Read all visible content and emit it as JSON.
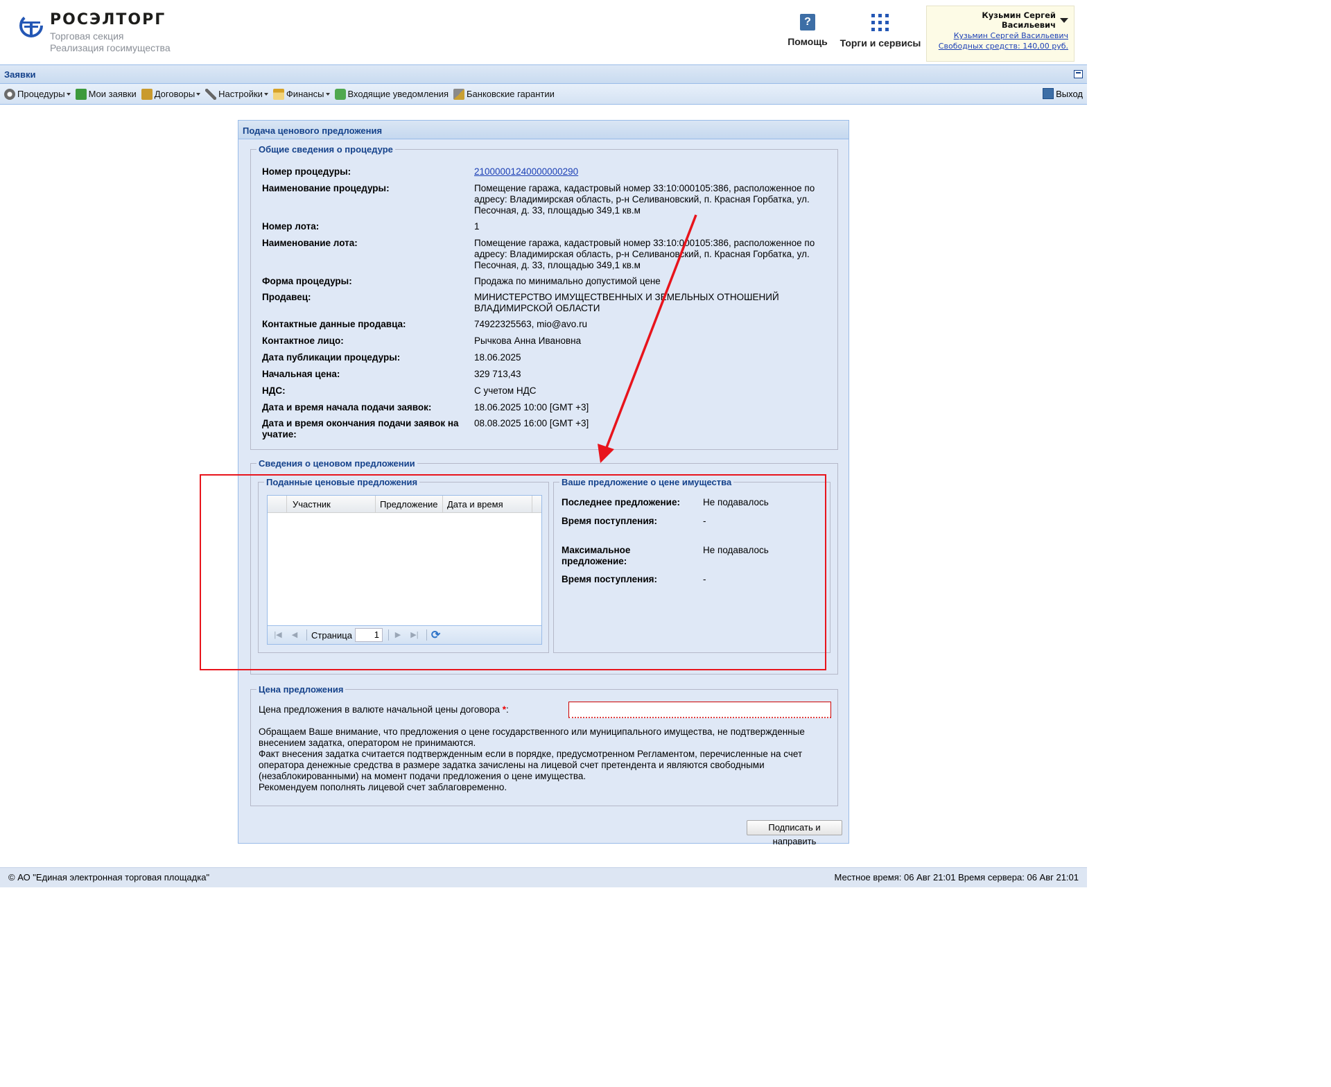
{
  "header": {
    "logo_title": "РОСЭЛТОРГ",
    "logo_sub1": "Торговая секция",
    "logo_sub2": "Реализация госимущества",
    "help_label": "Помощь",
    "services_label": "Торги и сервисы",
    "user_name": "Кузьмин Сергей Васильевич",
    "user_link": "Кузьмин Сергей Васильевич",
    "funds_link": "Свободных средств: 140,00 руб."
  },
  "panel": {
    "title": "Заявки"
  },
  "toolbar": {
    "items": [
      {
        "label": "Процедуры",
        "icon": "gear-icon"
      },
      {
        "label": "Мои заявки",
        "icon": "document-icon"
      },
      {
        "label": "Договоры",
        "icon": "contract-icon"
      },
      {
        "label": "Настройки",
        "icon": "wrench-icon"
      },
      {
        "label": "Финансы",
        "icon": "bank-icon"
      },
      {
        "label": "Входящие уведомления",
        "icon": "notification-icon"
      },
      {
        "label": "Банковские гарантии",
        "icon": "guarantee-icon"
      }
    ],
    "exit_label": "Выход"
  },
  "form": {
    "title": "Подача ценового предложения",
    "general_legend": "Общие сведения о процедуре",
    "general": [
      {
        "label": "Номер процедуры:",
        "value": "21000001240000000290"
      },
      {
        "label": "Наименование процедуры:",
        "value": "Помещение гаража, кадастровый номер 33:10:000105:386, расположенное по адресу: Владимирская область, р-н Селивановский, п. Красная Горбатка, ул. Песочная, д. 33, площадью 349,1 кв.м"
      },
      {
        "label": "Номер лота:",
        "value": "1"
      },
      {
        "label": "Наименование лота:",
        "value": "Помещение гаража, кадастровый номер 33:10:000105:386, расположенное по адресу: Владимирская область, р-н Селивановский, п. Красная Горбатка, ул. Песочная, д. 33, площадью 349,1 кв.м"
      },
      {
        "label": "Форма процедуры:",
        "value": "Продажа по минимально допустимой цене"
      },
      {
        "label": "Продавец:",
        "value": "МИНИСТЕРСТВО ИМУЩЕСТВЕННЫХ И ЗЕМЕЛЬНЫХ ОТНОШЕНИЙ ВЛАДИМИРСКОЙ ОБЛАСТИ"
      },
      {
        "label": "Контактные данные продавца:",
        "value": "74922325563, mio@avo.ru"
      },
      {
        "label": "Контактное лицо:",
        "value": "Рычкова Анна Ивановна"
      },
      {
        "label": "Дата публикации процедуры:",
        "value": "18.06.2025"
      },
      {
        "label": "Начальная цена:",
        "value": "329 713,43"
      },
      {
        "label": "НДС:",
        "value": "С учетом НДС"
      },
      {
        "label": "Дата и время начала подачи заявок:",
        "value": "18.06.2025 10:00 [GMT +3]"
      },
      {
        "label": "Дата и время окончания подачи заявок на учатие:",
        "value": "08.08.2025 16:00 [GMT +3]"
      }
    ],
    "price_info_legend": "Сведения о ценовом предложении",
    "submitted_legend": "Поданные ценовые предложения",
    "grid_columns": [
      "Участник",
      "Предложение",
      "Дата и время"
    ],
    "pager_label": "Страница",
    "pager_value": "1",
    "your_legend": "Ваше предложение о цене имущества",
    "your": [
      {
        "label": "Последнее предложение:",
        "value": "Не подавалось"
      },
      {
        "label": "Время поступления:",
        "value": "-"
      },
      {
        "label": "Максимальное предложение:",
        "value": "Не подавалось"
      },
      {
        "label": "Время поступления:",
        "value": "-"
      }
    ],
    "price_legend": "Цена предложения",
    "price_label": "Цена предложения в валюте начальной цены договора",
    "price_value": "",
    "notice": [
      "Обращаем Ваше внимание, что предложения о цене государственного или муниципального имущества, не подтвержденные внесением задатка, оператором не принимаются.",
      "Факт внесения задатка считается подтвержденным если в порядке, предусмотренном Регламентом, перечисленные на счет оператора денежные средства в размере задатка зачислены на лицевой счет претендента и являются свободными (незаблокированными) на момент подачи предложения о цене имущества.",
      "Рекомендуем пополнять лицевой счет заблаговременно."
    ],
    "submit_label": "Подписать и направить"
  },
  "footer": {
    "copyright": "© АО \"Единая электронная торговая площадка\"",
    "time": "Местное время: 06 Авг 21:01 Время сервера: 06 Авг 21:01"
  },
  "colors": {
    "accent": "#15428b",
    "annotation": "#e8141c",
    "link": "#1b3fb5"
  }
}
